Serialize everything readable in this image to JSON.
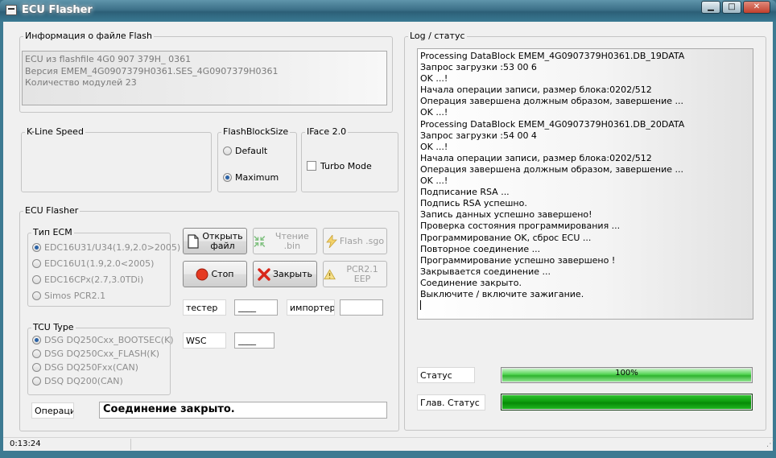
{
  "window": {
    "title": "ECU Flasher"
  },
  "window_buttons": {
    "minimize": "▁",
    "maximize": "□",
    "close": "✕"
  },
  "file_info": {
    "legend": "Информация  о файле Flash",
    "lines": [
      "ECU из flashfile 4G0 907 379H_ 0361",
      "Версия EMEM_4G0907379H0361.SES_4G0907379H0361",
      "Количество модулей 23"
    ]
  },
  "kline": {
    "legend": "K-Line Speed"
  },
  "flashblocksize": {
    "legend": "FlashBlockSize",
    "options": [
      {
        "label": "Default",
        "selected": false
      },
      {
        "label": "Maximum",
        "selected": true
      }
    ]
  },
  "iface": {
    "legend": "IFace 2.0",
    "turbo_label": "Turbo Mode",
    "turbo_checked": false
  },
  "ecu_flasher": {
    "legend": "ECU Flasher",
    "ecm_type": {
      "legend": "Тип ECM",
      "options": [
        {
          "label": "EDC16U31/U34(1.9,2.0>2005)",
          "selected": true
        },
        {
          "label": "EDC16U1(1.9,2.0<2005)",
          "selected": false
        },
        {
          "label": "EDC16CPx(2.7,3.0TDi)",
          "selected": false
        },
        {
          "label": "Simos PCR2.1",
          "selected": false
        }
      ]
    },
    "tcu_type": {
      "legend": "TCU Type",
      "options": [
        {
          "label": "DSG DQ250Cxx_BOOTSEC(K)",
          "selected": true
        },
        {
          "label": "DSG DQ250Cxx_FLASH(K)",
          "selected": false
        },
        {
          "label": "DSG DQ250Fxx(CAN)",
          "selected": false
        },
        {
          "label": "DSQ DQ200(CAN)",
          "selected": false
        }
      ]
    },
    "buttons": {
      "open_line1": "Открыть",
      "open_line2": "файл",
      "read_bin": "Чтение .bin",
      "flash_sgo": "Flash .sgo",
      "stop": "Стоп",
      "close": "Закрыть",
      "pcr": "PCR2.1 EEP"
    },
    "tester_label": "тестер",
    "tester_value": "____",
    "importer_label": "импортер",
    "importer_value": "",
    "wsc_label": "WSC",
    "wsc_value": "____",
    "operation_label": "Операция",
    "operation_value": "Соединение закрыто."
  },
  "log": {
    "legend": "Log / статус",
    "lines": [
      "Processing DataBlock EMEM_4G0907379H0361.DB_19DATA",
      "Запрос загрузки :53 00 6",
      "OK ...!",
      "Начала операции записи, размер блока:0202/512",
      "Операция завершена должным образом, завершение ...",
      "OK ...!",
      "Processing DataBlock EMEM_4G0907379H0361.DB_20DATA",
      "Запрос загрузки :54 00 4",
      "OK ...!",
      "Начала операции записи, размер блока:0202/512",
      "Операция завершена должным образом, завершение ...",
      "OK ...!",
      "Подписание RSA ...",
      "Подпись RSA успешно.",
      "Запись данных успешно завершено!",
      "Проверка состояния программирования ...",
      "Программирование OK, сброс ECU ...",
      "Повторное соединение ...",
      "Программирование успешно завершено !",
      "Закрывается соединение ...",
      "Соединение закрыто.",
      "Выключите / включите зажигание."
    ]
  },
  "status": {
    "label": "Статус",
    "progress_text": "100%",
    "progress": 1.0
  },
  "main_status": {
    "label": "Глав. Статус",
    "progress": 1.0
  },
  "statusbar": {
    "time": "0:13:24"
  },
  "colors": {
    "accent_green": "#2fb32f",
    "title_bar": "#3c7088"
  }
}
